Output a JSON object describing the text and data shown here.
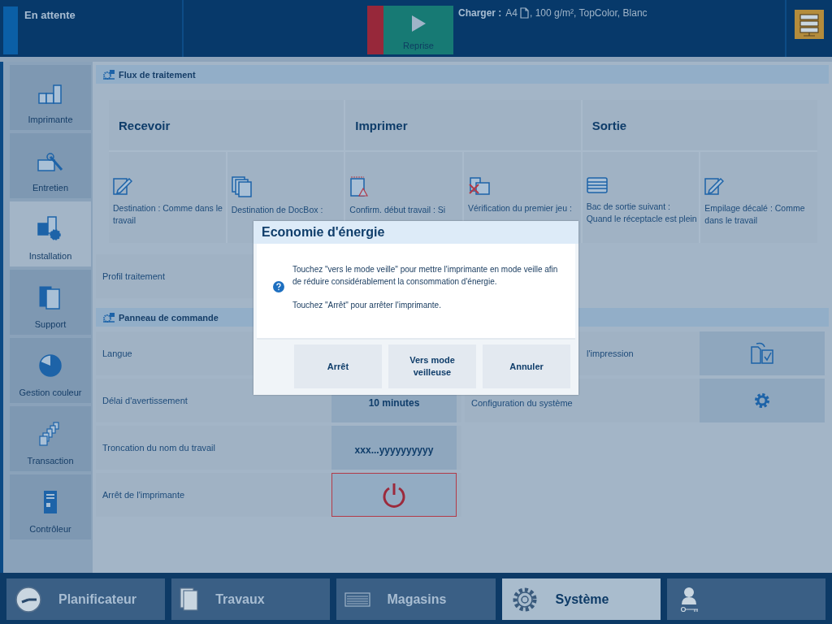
{
  "status": {
    "text": "En attente"
  },
  "resume_button": {
    "label": "Reprise"
  },
  "load_info": {
    "label": "Charger :",
    "size": "A4",
    "details": ", 100 g/m², TopColor, Blanc"
  },
  "sidebar": {
    "items": [
      {
        "label": "Imprimante",
        "kind": "printer",
        "selected": false
      },
      {
        "label": "Entretien",
        "kind": "maintenance",
        "selected": false
      },
      {
        "label": "Installation",
        "kind": "setup",
        "selected": true
      },
      {
        "label": "Support",
        "kind": "media",
        "selected": false
      },
      {
        "label": "Gestion couleur",
        "kind": "color",
        "selected": false
      },
      {
        "label": "Transaction",
        "kind": "transaction",
        "selected": false
      },
      {
        "label": "Contrôleur",
        "kind": "controller",
        "selected": false
      }
    ]
  },
  "workflow": {
    "title": "Flux de traitement",
    "columns": [
      {
        "title": "Recevoir",
        "items": [
          {
            "kind": "edit",
            "text": "Destination : Comme dans le travail"
          },
          {
            "kind": "docbox",
            "text": "Destination de DocBox :"
          }
        ]
      },
      {
        "title": "Imprimer",
        "items": [
          {
            "kind": "confirm",
            "text": "Confirm. début travail : Si"
          },
          {
            "kind": "proof",
            "text": "Vérification du premier jeu :"
          }
        ]
      },
      {
        "title": "Sortie",
        "items": [
          {
            "kind": "tray",
            "text": "Bac de sortie suivant : Quand le réceptacle est plein"
          },
          {
            "kind": "edit",
            "text": "Empilage décalé : Comme dans le travail"
          }
        ]
      }
    ]
  },
  "processing_profile": {
    "label": "Profil traitement"
  },
  "control_panel": {
    "title": "Panneau de commande",
    "left_rows": [
      {
        "label": "Langue",
        "kind": "hidden"
      },
      {
        "label": "Délai d'avertissement",
        "kind": "value",
        "value": "10 minutes"
      },
      {
        "label": "Troncation du nom du travail",
        "kind": "value",
        "value": "xxx...yyyyyyyyyy"
      },
      {
        "label": "Arrêt de l'imprimante",
        "kind": "power"
      }
    ],
    "right_rows": [
      {
        "label": "l'impression",
        "kind": "doc-check"
      },
      {
        "label": "Configuration du système",
        "kind": "gear"
      }
    ]
  },
  "dialog": {
    "title": "Economie d'énergie",
    "paragraphs": [
      "Touchez \"vers le mode veille\" pour mettre l'imprimante en mode veille afin de réduire considérablement la consommation d'énergie.",
      "Touchez \"Arrêt\" pour arrêter l'imprimante."
    ],
    "buttons": [
      "Arrêt",
      "Vers mode veilleuse",
      "Annuler"
    ]
  },
  "bottom_tabs": [
    {
      "label": "Planificateur",
      "kind": "clock",
      "selected": false
    },
    {
      "label": "Travaux",
      "kind": "jobs",
      "selected": false
    },
    {
      "label": "Magasins",
      "kind": "trays",
      "selected": false
    },
    {
      "label": "Système",
      "kind": "gear",
      "selected": true
    },
    {
      "kind": "user",
      "selected": false
    }
  ]
}
